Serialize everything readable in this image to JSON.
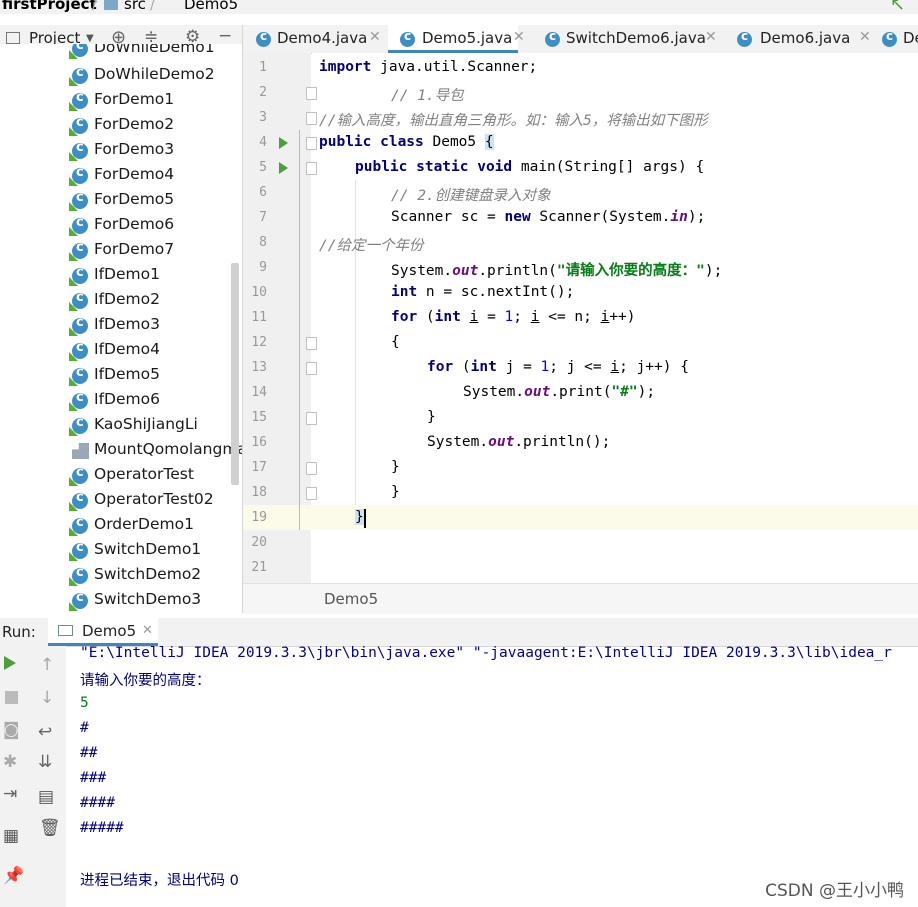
{
  "breadcrumb": {
    "project": "firstProject",
    "folder": "src",
    "file": "Demo5"
  },
  "project_panel": {
    "title": "Project"
  },
  "tree": {
    "items": [
      {
        "label": "DoWhileDemo1",
        "icon": "class-icon"
      },
      {
        "label": "DoWhileDemo2",
        "icon": "class-icon"
      },
      {
        "label": "ForDemo1",
        "icon": "class-icon"
      },
      {
        "label": "ForDemo2",
        "icon": "class-icon"
      },
      {
        "label": "ForDemo3",
        "icon": "class-icon"
      },
      {
        "label": "ForDemo4",
        "icon": "class-icon"
      },
      {
        "label": "ForDemo5",
        "icon": "class-icon"
      },
      {
        "label": "ForDemo6",
        "icon": "class-icon"
      },
      {
        "label": "ForDemo7",
        "icon": "class-icon"
      },
      {
        "label": "IfDemo1",
        "icon": "class-icon"
      },
      {
        "label": "IfDemo2",
        "icon": "class-icon"
      },
      {
        "label": "IfDemo3",
        "icon": "class-icon"
      },
      {
        "label": "IfDemo4",
        "icon": "class-icon"
      },
      {
        "label": "IfDemo5",
        "icon": "class-icon"
      },
      {
        "label": "IfDemo6",
        "icon": "class-icon"
      },
      {
        "label": "KaoShiJiangLi",
        "icon": "class-icon"
      },
      {
        "label": "MountQomolangma",
        "icon": "file-icon"
      },
      {
        "label": "OperatorTest",
        "icon": "class-icon"
      },
      {
        "label": "OperatorTest02",
        "icon": "class-icon"
      },
      {
        "label": "OrderDemo1",
        "icon": "class-icon"
      },
      {
        "label": "SwitchDemo1",
        "icon": "class-icon"
      },
      {
        "label": "SwitchDemo2",
        "icon": "class-icon"
      },
      {
        "label": "SwitchDemo3",
        "icon": "class-icon"
      }
    ]
  },
  "tabs": [
    {
      "label": "Demo4.java",
      "active": false
    },
    {
      "label": "Demo5.java",
      "active": true
    },
    {
      "label": "SwitchDemo6.java",
      "active": false
    },
    {
      "label": "Demo6.java",
      "active": false
    },
    {
      "label": "De",
      "active": false
    }
  ],
  "editor": {
    "line_numbers": [
      "1",
      "2",
      "3",
      "4",
      "5",
      "6",
      "7",
      "8",
      "9",
      "10",
      "11",
      "12",
      "13",
      "14",
      "15",
      "16",
      "17",
      "18",
      "19",
      "20",
      "21"
    ],
    "code": {
      "l1_kw": "import",
      "l1_rest": " java.util.Scanner;",
      "l2": "// 1.导包",
      "l3": "//输入高度，输出直角三角形。如：输入5，将输出如下图形",
      "l4_kw": "public class",
      "l4_rest": " Demo5 ",
      "l5_kw": "public static void",
      "l5_rest": " main(String[] args) {",
      "l6": "// 2.创建键盘录入对象",
      "l7_a": "Scanner sc = ",
      "l7_kw": "new",
      "l7_b": " Scanner(System.",
      "l7_fd": "in",
      "l7_c": ");",
      "l8": "//给定一个年份",
      "l9_a": "System.",
      "l9_fd": "out",
      "l9_b": ".println(",
      "l9_st": "\"请输入你要的高度：\"",
      "l9_c": ");",
      "l10_kw": "int",
      "l10_rest": " n = sc.nextInt();",
      "l11_kw1": "for",
      "l11_a": " (",
      "l11_kw2": "int",
      "l11_b": " ",
      "l11_i1": "i",
      "l11_c": " = ",
      "l11_n1": "1",
      "l11_d": "; ",
      "l11_i2": "i",
      "l11_e": " <= n; ",
      "l11_i3": "i",
      "l11_f": "++)",
      "l12": "{",
      "l13_kw1": "for",
      "l13_a": " (",
      "l13_kw2": "int",
      "l13_b": " j = ",
      "l13_n": "1",
      "l13_c": "; j <= ",
      "l13_i": "i",
      "l13_d": "; j++) {",
      "l14_a": "System.",
      "l14_fd": "out",
      "l14_b": ".print(",
      "l14_st": "\"#\"",
      "l14_c": ");",
      "l15": "}",
      "l16_a": "System.",
      "l16_fd": "out",
      "l16_b": ".println();",
      "l17": "}",
      "l18": "}",
      "l19": "}"
    },
    "footer_crumb": "Demo5"
  },
  "run": {
    "label": "Run:",
    "tab": "Demo5",
    "output": [
      "\"E:\\IntelliJ IDEA 2019.3.3\\jbr\\bin\\java.exe\" \"-javaagent:E:\\IntelliJ IDEA 2019.3.3\\lib\\idea_r",
      "请输入你要的高度：",
      "5",
      "#",
      "##",
      "###",
      "####",
      "#####",
      "进程已结束，退出代码 0"
    ]
  },
  "watermark": "CSDN @王小小鸭",
  "colors": {
    "keyword": "#000080",
    "comment": "#808080",
    "string": "#067d17",
    "field": "#660e7a",
    "number": "#0000ff",
    "class_icon": "#3d8ec4",
    "run_green": "#4b9e3c"
  }
}
